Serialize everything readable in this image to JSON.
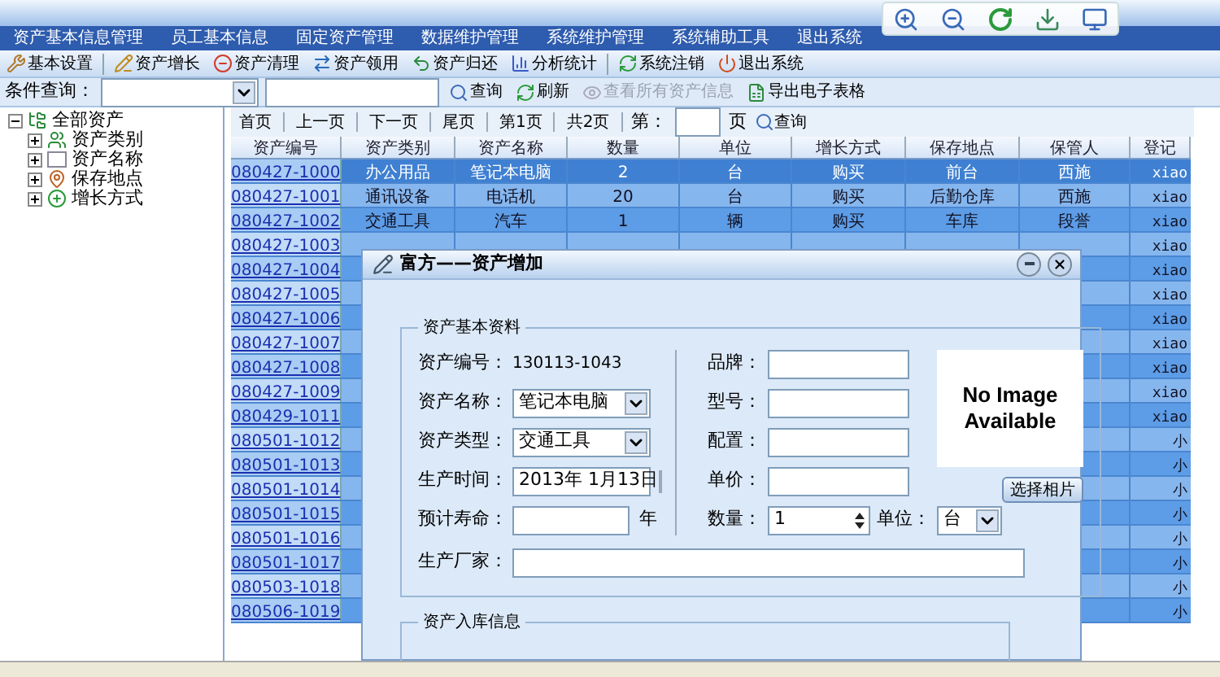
{
  "menu": [
    "资产基本信息管理",
    "员工基本信息",
    "固定资产管理",
    "数据维护管理",
    "系统维护管理",
    "系统辅助工具",
    "退出系统"
  ],
  "toolbar": [
    "基本设置",
    "资产增长",
    "资产清理",
    "资产领用",
    "资产归还",
    "分析统计",
    "系统注销",
    "退出系统"
  ],
  "query_bar": {
    "label": "条件查询：",
    "buttons": [
      {
        "label": "查询",
        "disabled": false
      },
      {
        "label": "刷新",
        "disabled": false
      },
      {
        "label": "查看所有资产信息",
        "disabled": true
      },
      {
        "label": "导出电子表格",
        "disabled": false
      }
    ]
  },
  "tree": {
    "label": "全部资产",
    "expanded": true,
    "children": [
      {
        "label": "资产类别",
        "expanded": false
      },
      {
        "label": "资产名称",
        "expanded": false
      },
      {
        "label": "保存地点",
        "expanded": false
      },
      {
        "label": "增长方式",
        "expanded": false
      }
    ]
  },
  "pager": {
    "buttons": [
      "首页",
      "上一页",
      "下一页",
      "尾页",
      "第1页",
      "共2页"
    ],
    "goto_label": "第：",
    "goto_suffix": "页",
    "query": "查询"
  },
  "table": {
    "columns": [
      "资产编号",
      "资产类别",
      "资产名称",
      "数量",
      "单位",
      "增长方式",
      "保存地点",
      "保管人",
      "登记"
    ],
    "rows": [
      {
        "selected": true,
        "id": "080427-1000",
        "details": [
          "办公用品",
          "笔记本电脑",
          "2",
          "台",
          "购买",
          "前台",
          "西施"
        ],
        "registrar": "xiao"
      },
      {
        "selected": false,
        "id": "080427-1001",
        "details": [
          "通讯设备",
          "电话机",
          "20",
          "台",
          "购买",
          "后勤仓库",
          "西施"
        ],
        "registrar": "xiao"
      },
      {
        "selected": false,
        "id": "080427-1002",
        "details": [
          "交通工具",
          "汽车",
          "1",
          "辆",
          "购买",
          "车库",
          "段誉"
        ],
        "registrar": "xiao"
      },
      {
        "selected": false,
        "id": "080427-1003",
        "registrar": "xiao"
      },
      {
        "selected": false,
        "id": "080427-1004",
        "registrar": "xiao"
      },
      {
        "selected": false,
        "id": "080427-1005",
        "registrar": "xiao"
      },
      {
        "selected": false,
        "id": "080427-1006",
        "registrar": "xiao"
      },
      {
        "selected": false,
        "id": "080427-1007",
        "registrar": "xiao"
      },
      {
        "selected": false,
        "id": "080427-1008",
        "registrar": "xiao"
      },
      {
        "selected": false,
        "id": "080427-1009",
        "registrar": "xiao"
      },
      {
        "selected": false,
        "id": "080429-1011",
        "registrar": "xiao"
      },
      {
        "selected": false,
        "id": "080501-1012",
        "registrar": "小"
      },
      {
        "selected": false,
        "id": "080501-1013",
        "registrar": "小"
      },
      {
        "selected": false,
        "id": "080501-1014",
        "registrar": "小"
      },
      {
        "selected": false,
        "id": "080501-1015",
        "registrar": "小"
      },
      {
        "selected": false,
        "id": "080501-1016",
        "registrar": "小"
      },
      {
        "selected": false,
        "id": "080501-1017",
        "registrar": "小"
      },
      {
        "selected": false,
        "id": "080503-1018",
        "registrar": "小"
      },
      {
        "selected": false,
        "id": "080506-1019",
        "registrar": "小"
      }
    ]
  },
  "dialog": {
    "title": "富方——资产增加",
    "basic_group": {
      "title": "资产基本资料",
      "asset_no": {
        "label": "资产编号：",
        "value": "130113-1043"
      },
      "asset_name": {
        "label": "资产名称：",
        "value": "笔记本电脑"
      },
      "asset_type": {
        "label": "资产类型：",
        "value": "交通工具"
      },
      "production_date": {
        "label": "生产时间：",
        "value": "2013年 1月13日"
      },
      "lifespan": {
        "label": "预计寿命：",
        "unit": "年"
      },
      "brand": {
        "label": "品牌："
      },
      "model": {
        "label": "型号："
      },
      "config": {
        "label": "配置："
      },
      "price": {
        "label": "单价："
      },
      "quantity": {
        "label": "数量：",
        "value": "1"
      },
      "unit": {
        "label": "单位：",
        "value": "台"
      },
      "photo": {
        "text": "No Image Available"
      },
      "photo_button": "选择相片",
      "manufacturer": {
        "label": "生产厂家："
      }
    },
    "stock_group": {
      "title": "资产入库信息"
    }
  }
}
